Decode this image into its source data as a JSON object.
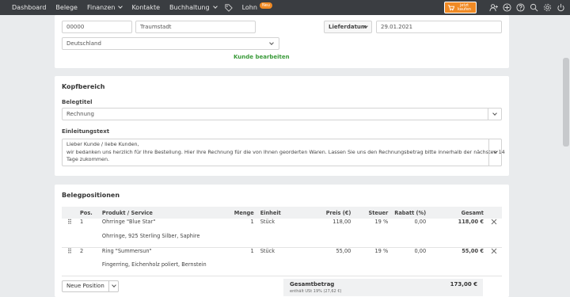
{
  "nav": {
    "items": [
      {
        "label": "Dashboard",
        "dropdown": false
      },
      {
        "label": "Belege",
        "dropdown": false
      },
      {
        "label": "Finanzen",
        "dropdown": true
      },
      {
        "label": "Kontakte",
        "dropdown": false
      },
      {
        "label": "Buchhaltung",
        "dropdown": true
      }
    ],
    "lohn_label": "Lohn",
    "lohn_badge": "Neu",
    "buy_line1": "jetzt",
    "buy_line2": "kaufen",
    "icons": [
      "user-add-icon",
      "plus-circle-icon",
      "help-icon",
      "search-icon",
      "settings-icon",
      "power-icon"
    ],
    "accent": "#f08a24"
  },
  "address": {
    "zip": "00000",
    "city": "Traumstadt",
    "country": "Deutschland",
    "edit_link": "Kunde bearbeiten",
    "date_type": "Lieferdatum",
    "date_value": "29.01.2021"
  },
  "kopf": {
    "title": "Kopfbereich",
    "belegtitel_label": "Belegtitel",
    "belegtitel_value": "Rechnung",
    "einleitung_label": "Einleitungstext",
    "einleitung_lines": [
      "Lieber Kunde / liebe Kunden,",
      "wir bedanken uns herzlich für Ihre Bestellung. Hier Ihre Rechnung für die von Ihnen georderten Waren. Lassen Sie uns den Rechnungsbetrag bitte innerhalb der nächsten 14",
      "Tage zukommen."
    ]
  },
  "positions": {
    "title": "Belegpositionen",
    "columns": [
      "Pos.",
      "Produkt / Service",
      "Menge",
      "Einheit",
      "Preis (€)",
      "Steuer",
      "Rabatt (%)",
      "Gesamt"
    ],
    "rows": [
      {
        "pos": "1",
        "product": "Ohrringe \"Blue Star\"",
        "desc": "Ohrringe, 925 Sterling Silber, Saphire",
        "menge": "1",
        "einheit": "Stück",
        "preis": "118,00",
        "steuer": "19 %",
        "rabatt": "0,00",
        "gesamt": "118,00 €"
      },
      {
        "pos": "2",
        "product": "Ring \"Summersun\"",
        "desc": "Fingerring, Eichenholz poliert, Bernstein",
        "menge": "1",
        "einheit": "Stück",
        "preis": "55,00",
        "steuer": "19 %",
        "rabatt": "0,00",
        "gesamt": "55,00 €"
      }
    ],
    "new_button": "Neue Position",
    "sum_label": "Gesamtbetrag",
    "sum_value": "173,00 €",
    "sum_sub": "enthält USt 19% (27,62 €)"
  }
}
